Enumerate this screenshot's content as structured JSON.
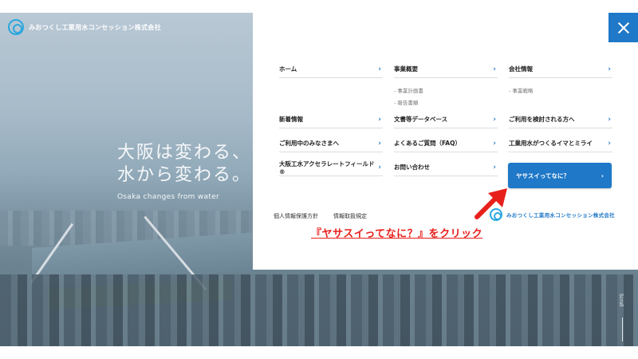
{
  "brand": {
    "name": "みおつくし工業用水コンセッション株式会社"
  },
  "hero": {
    "catch_line1": "大阪は変わる、",
    "catch_line2": "水から変わる。",
    "catch_en": "Osaka changes from water",
    "scroll_label": "Scroll"
  },
  "menu": {
    "col1": [
      {
        "label": "ホーム"
      },
      {
        "label": "新着情報"
      },
      {
        "label": "ご利用中のみなさまへ"
      },
      {
        "label": "大阪工水アクセラレートフィールド®"
      }
    ],
    "col2": [
      {
        "label": "事業概要",
        "subs": [
          "- 事業計画書",
          "- 報告書類"
        ]
      },
      {
        "label": "文書等データベース"
      },
      {
        "label": "よくあるご質問（FAQ）"
      },
      {
        "label": "お問い合わせ"
      }
    ],
    "col3": [
      {
        "label": "会社情報",
        "subs": [
          "- 事業戦略"
        ]
      },
      {
        "label": "ご利用を検討される方へ"
      },
      {
        "label": "工業用水がつくるイマとミライ"
      }
    ],
    "cta_label": "ヤサスイってなに？",
    "footer_links": [
      "個人情報保護方針",
      "情報取扱規定"
    ],
    "chevron": "›"
  },
  "annotation": {
    "text": "『ヤサスイってなに？』をクリック"
  },
  "colors": {
    "accent": "#1f78c8",
    "annotation": "#e8201c"
  }
}
